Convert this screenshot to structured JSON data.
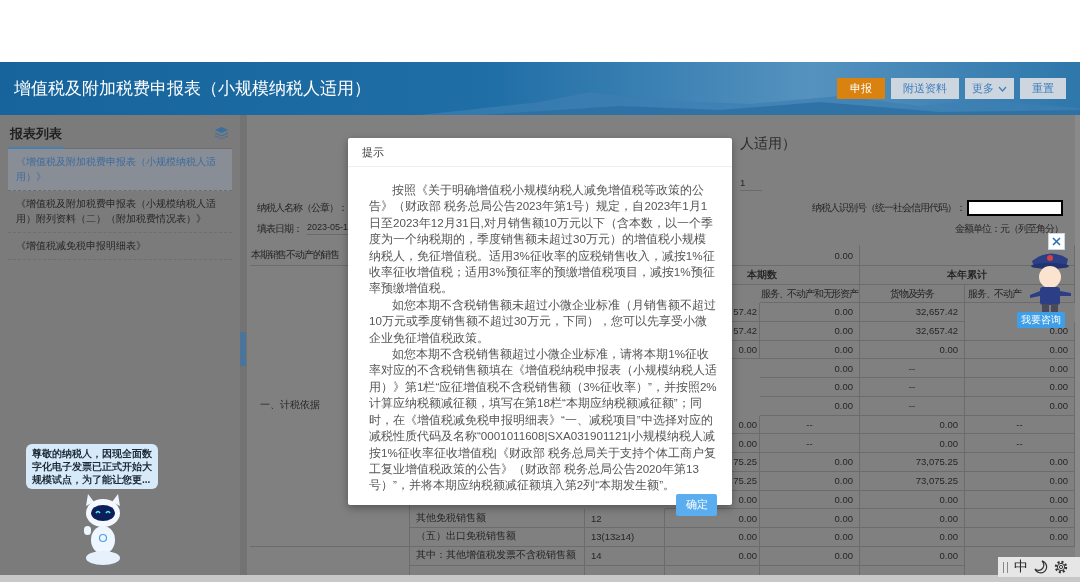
{
  "header": {
    "title": "增值税及附加税费申报表（小规模纳税人适用）",
    "buttons": [
      {
        "label": "申报",
        "kind": "primary"
      },
      {
        "label": "附送资料",
        "kind": "default"
      },
      {
        "label": "更多",
        "kind": "dropdown"
      },
      {
        "label": "重置",
        "kind": "default"
      }
    ]
  },
  "sidebar": {
    "title": "报表列表",
    "items": [
      {
        "label": "《增值税及附加税费申报表（小规模纳税人适用）》",
        "selected": true
      },
      {
        "label": "《增值税及附加税费申报表（小规模纳税人适用）附列资料（二）（附加税费情况表）》",
        "selected": false
      },
      {
        "label": "《增值税减免税申报明细表》",
        "selected": false
      }
    ]
  },
  "form": {
    "title_fragment": "人适用）",
    "period_fragment": "1",
    "taxpayer_name_label": "纳税人名称（公章）：",
    "date_label": "填表日期：",
    "date_value": "2023-05-1",
    "taxpayer_id_label": "纳税人识别号（统一社会信用代码）：",
    "unit": "金额单位：元（列至角分）"
  },
  "table": {
    "top_row": {
      "label": "本期销售不动产的销售",
      "value": "0.00"
    },
    "group_headers": [
      "本期数",
      "本年累计"
    ],
    "columns": [
      null,
      "服务、不动产和无形资产",
      "货物及劳务",
      "服务、不动产"
    ],
    "section_label": "一、计税依据",
    "rows": [
      {
        "cells": [
          "57.42",
          "0.00",
          "32,657.42",
          null
        ]
      },
      {
        "cells": [
          "57.42",
          "0.00",
          "32,657.42",
          "0.00"
        ]
      },
      {
        "cells": [
          "0.00",
          "0.00",
          "0.00",
          "0.00"
        ]
      },
      {
        "cells": [
          null,
          "0.00",
          {
            "text": "--",
            "kind": "placeholder"
          },
          "0.00"
        ]
      },
      {
        "cells": [
          null,
          "0.00",
          {
            "text": "--",
            "kind": "placeholder"
          },
          "0.00"
        ]
      },
      {
        "cells": [
          null,
          "0.00",
          {
            "text": "--",
            "kind": "placeholder"
          },
          "0.00"
        ]
      },
      {
        "cells": [
          "0.00",
          {
            "text": "--",
            "kind": "placeholder"
          },
          "0.00",
          {
            "text": "--",
            "kind": "placeholder"
          }
        ]
      },
      {
        "cells": [
          "0.00",
          {
            "text": "--",
            "kind": "placeholder"
          },
          "0.00",
          {
            "text": "--",
            "kind": "placeholder"
          }
        ]
      },
      {
        "cells": [
          "75.25",
          "0.00",
          "73,075.25",
          "0.00"
        ]
      },
      {
        "cells": [
          "75.25",
          "0.00",
          "73,075.25",
          "0.00"
        ]
      },
      {
        "cells": [
          "0.00",
          "0.00",
          "0.00",
          "0.00"
        ]
      },
      {
        "label": "其他免税销售额",
        "line": "12",
        "cells": [
          "0.00",
          "0.00",
          "0.00",
          "0.00"
        ]
      },
      {
        "label": "（五）出口免税销售额",
        "line": "13(13≥14)",
        "cells": [
          "0.00",
          "0.00",
          "0.00",
          "0.00"
        ]
      },
      {
        "label": "其中：其他增值税发票不含税销售额",
        "line": "14",
        "cells": [
          "0.00",
          "0.00",
          "0.00",
          null
        ]
      }
    ]
  },
  "dialog": {
    "title": "提示",
    "paragraphs": [
      "按照《关于明确增值税小规模纳税人减免增值税等政策的公告》（财政部 税务总局公告2023年第1号）规定，自2023年1月1日至2023年12月31日,对月销售额10万元以下（含本数，以一个季度为一个纳税期的，季度销售额未超过30万元）的增值税小规模纳税人，免征增值税。适用3%征收率的应税销售收入，减按1%征收率征收增值税；适用3%预征率的预缴增值税项目，减按1%预征率预缴增值税。",
      "如您本期不含税销售额未超过小微企业标准（月销售额不超过10万元或季度销售额不超过30万元，下同），您可以先享受小微企业免征增值税政策。",
      "如您本期不含税销售额超过小微企业标准，请将本期1%征收率对应的不含税销售额填在《增值税纳税申报表（小规模纳税人适用）》第1栏“应征增值税不含税销售额（3%征收率）”，并按照2%计算应纳税额减征额，填写在第18栏“本期应纳税额减征额”；同时，在《增值税减免税申报明细表》“一、减税项目”中选择对应的减税性质代码及名称“0001011608|SXA031901121|小规模纳税人减按1%征收率征收增值税|《财政部 税务总局关于支持个体工商户复工复业增值税政策的公告》（财政部 税务总局公告2020年第13号）”，并将本期应纳税额减征额填入第2列“本期发生额”。"
    ],
    "button": "确定"
  },
  "assistant": {
    "bubble": "尊敬的纳税人，因现全面数字化电子发票已正式开始大规模试点，为了能让您更...",
    "consult_button": "我要咨询"
  },
  "toolbar": {
    "language": "中"
  }
}
